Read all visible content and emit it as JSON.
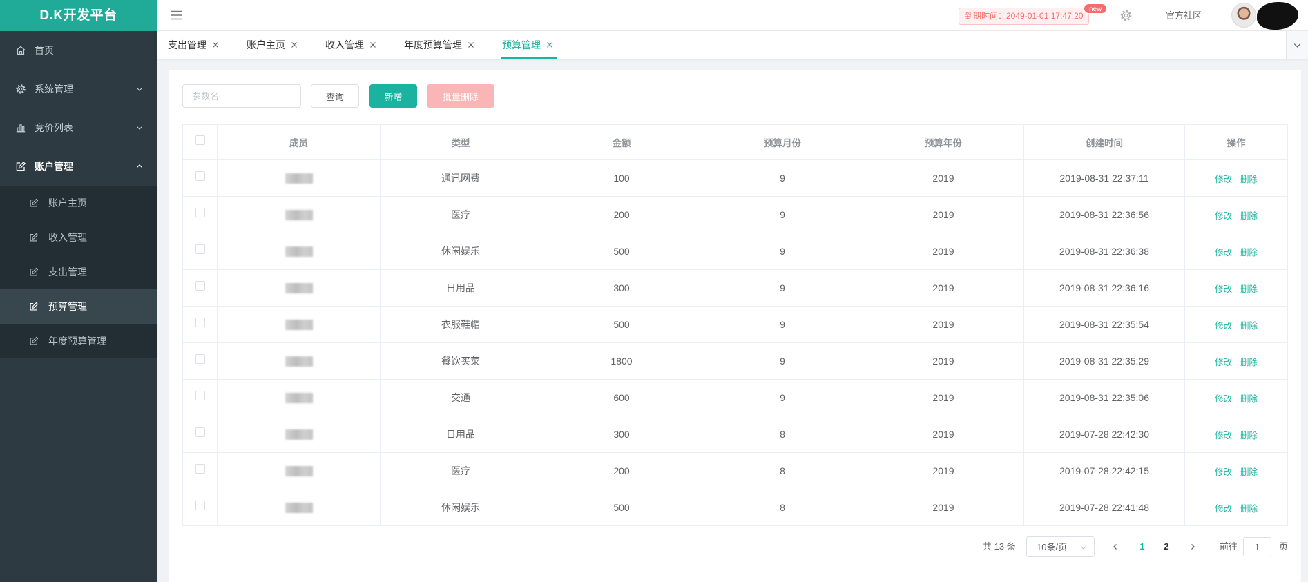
{
  "app": {
    "logo_text": "D.K开发平台"
  },
  "colors": {
    "accent": "#1ab39f",
    "logo_bg": "#1fab98",
    "sidebar_bg": "#2d3a41",
    "danger": "#f56c6c",
    "batch_delete_bg": "#fab6b6"
  },
  "sidebar": {
    "items": [
      {
        "label": "首页",
        "icon": "home-icon"
      },
      {
        "label": "系统管理",
        "icon": "gear-icon",
        "expanded": false
      },
      {
        "label": "竞价列表",
        "icon": "bar-chart-icon",
        "expanded": false
      },
      {
        "label": "账户管理",
        "icon": "edit-icon",
        "expanded": true
      }
    ],
    "submenu": [
      {
        "label": "账户主页",
        "icon": "edit-icon"
      },
      {
        "label": "收入管理",
        "icon": "edit-icon"
      },
      {
        "label": "支出管理",
        "icon": "edit-icon"
      },
      {
        "label": "预算管理",
        "icon": "edit-icon",
        "active": true
      },
      {
        "label": "年度预算管理",
        "icon": "edit-icon"
      }
    ]
  },
  "header": {
    "menu_toggle_icon": "hamburger-icon",
    "expiry_text": "到期时间：2049-01-01 17:47:20",
    "new_badge": "new",
    "settings_icon": "gear-icon",
    "community_link": "官方社区"
  },
  "tabs": [
    {
      "label": "支出管理"
    },
    {
      "label": "账户主页"
    },
    {
      "label": "收入管理"
    },
    {
      "label": "年度预算管理"
    },
    {
      "label": "预算管理",
      "active": true
    }
  ],
  "toolbar": {
    "search_placeholder": "参数名",
    "query_label": "查询",
    "add_label": "新增",
    "batch_delete_label": "批量删除"
  },
  "table": {
    "columns": [
      "成员",
      "类型",
      "金额",
      "预算月份",
      "预算年份",
      "创建时间",
      "操作"
    ],
    "edit_label": "修改",
    "delete_label": "删除",
    "rows": [
      {
        "type": "通讯网费",
        "amount": "100",
        "month": "9",
        "year": "2019",
        "created": "2019-08-31 22:37:11"
      },
      {
        "type": "医疗",
        "amount": "200",
        "month": "9",
        "year": "2019",
        "created": "2019-08-31 22:36:56"
      },
      {
        "type": "休闲娱乐",
        "amount": "500",
        "month": "9",
        "year": "2019",
        "created": "2019-08-31 22:36:38"
      },
      {
        "type": "日用品",
        "amount": "300",
        "month": "9",
        "year": "2019",
        "created": "2019-08-31 22:36:16"
      },
      {
        "type": "衣服鞋帽",
        "amount": "500",
        "month": "9",
        "year": "2019",
        "created": "2019-08-31 22:35:54"
      },
      {
        "type": "餐饮买菜",
        "amount": "1800",
        "month": "9",
        "year": "2019",
        "created": "2019-08-31 22:35:29"
      },
      {
        "type": "交通",
        "amount": "600",
        "month": "9",
        "year": "2019",
        "created": "2019-08-31 22:35:06"
      },
      {
        "type": "日用品",
        "amount": "300",
        "month": "8",
        "year": "2019",
        "created": "2019-07-28 22:42:30"
      },
      {
        "type": "医疗",
        "amount": "200",
        "month": "8",
        "year": "2019",
        "created": "2019-07-28 22:42:15"
      },
      {
        "type": "休闲娱乐",
        "amount": "500",
        "month": "8",
        "year": "2019",
        "created": "2019-07-28 22:41:48"
      }
    ]
  },
  "pagination": {
    "total_text": "共 13 条",
    "page_size": "10条/页",
    "pages": [
      {
        "label": "1",
        "active": true
      },
      {
        "label": "2",
        "active": false
      }
    ],
    "goto_label": "前往",
    "goto_value": "1",
    "page_suffix": "页"
  }
}
